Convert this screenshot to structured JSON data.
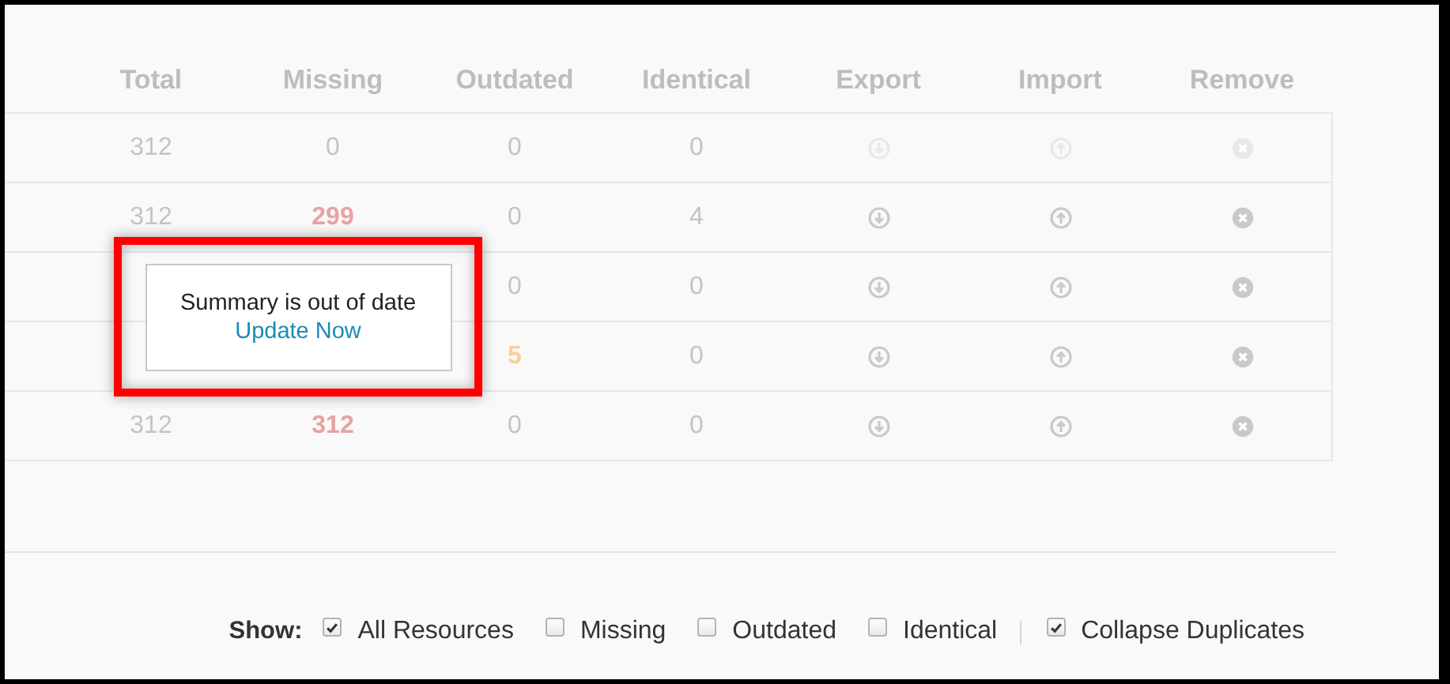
{
  "table": {
    "columns": [
      "Total",
      "Missing",
      "Outdated",
      "Identical",
      "Export",
      "Import",
      "Remove"
    ],
    "rows": [
      {
        "cells": {
          "total": {
            "text": "312",
            "kind": "plain"
          },
          "missing": {
            "text": "0",
            "kind": "plain"
          },
          "outdated": {
            "text": "0",
            "kind": "plain"
          },
          "identical": {
            "text": "0",
            "kind": "plain"
          }
        },
        "disabled": true
      },
      {
        "cells": {
          "total": {
            "text": "312",
            "kind": "plain"
          },
          "missing": {
            "text": "299",
            "kind": "missing"
          },
          "outdated": {
            "text": "0",
            "kind": "plain"
          },
          "identical": {
            "text": "4",
            "kind": "plain"
          }
        },
        "disabled": false
      },
      {
        "cells": {
          "outdated": {
            "text": "0",
            "kind": "plain"
          },
          "identical": {
            "text": "0",
            "kind": "plain"
          }
        },
        "disabled": false
      },
      {
        "cells": {
          "outdated": {
            "text": "5",
            "kind": "outdated"
          },
          "identical": {
            "text": "0",
            "kind": "plain"
          }
        },
        "disabled": false
      },
      {
        "cells": {
          "total": {
            "text": "312",
            "kind": "plain"
          },
          "missing": {
            "text": "312",
            "kind": "missing"
          },
          "outdated": {
            "text": "0",
            "kind": "plain"
          },
          "identical": {
            "text": "0",
            "kind": "plain"
          }
        },
        "disabled": false
      }
    ]
  },
  "tooltip": {
    "message": "Summary is out of date",
    "link": "Update Now",
    "highlighted": true
  },
  "filters": {
    "label": "Show:",
    "options": [
      {
        "label": "All Resources",
        "checked": true
      },
      {
        "label": "Missing",
        "checked": false
      },
      {
        "label": "Outdated",
        "checked": false
      },
      {
        "label": "Identical",
        "checked": false
      }
    ],
    "extra_options": [
      {
        "label": "Collapse Duplicates",
        "checked": true
      }
    ]
  }
}
